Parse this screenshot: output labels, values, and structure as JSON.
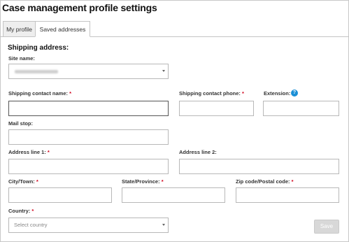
{
  "page": {
    "title": "Case management profile settings"
  },
  "tabs": [
    {
      "label": "My profile",
      "active": false
    },
    {
      "label": "Saved addresses",
      "active": true
    }
  ],
  "shipping": {
    "section_title": "Shipping address:",
    "site_name": {
      "label": "Site name:",
      "value": ""
    },
    "contact_name": {
      "label": "Shipping contact name:",
      "required_mark": "*",
      "value": ""
    },
    "contact_phone": {
      "label": "Shipping contact phone:",
      "required_mark": "*",
      "value": ""
    },
    "extension": {
      "label": "Extension:",
      "info_icon": "?"
    },
    "mail_stop": {
      "label": "Mail stop:",
      "value": ""
    },
    "address1": {
      "label": "Address line 1:",
      "required_mark": "*",
      "value": ""
    },
    "address2": {
      "label": "Address line 2:",
      "value": ""
    },
    "city": {
      "label": "City/Town:",
      "required_mark": "*",
      "value": ""
    },
    "state": {
      "label": "State/Province:",
      "required_mark": "*",
      "value": ""
    },
    "zip": {
      "label": "Zip code/Postal code:",
      "required_mark": "*",
      "value": ""
    },
    "country": {
      "label": "Country:",
      "required_mark": "*",
      "selected": "Select country"
    }
  },
  "actions": {
    "save_label": "Save"
  },
  "colors": {
    "required": "#d0021b",
    "info": "#1a8fd6",
    "disabled_button": "#d8d8d8"
  }
}
